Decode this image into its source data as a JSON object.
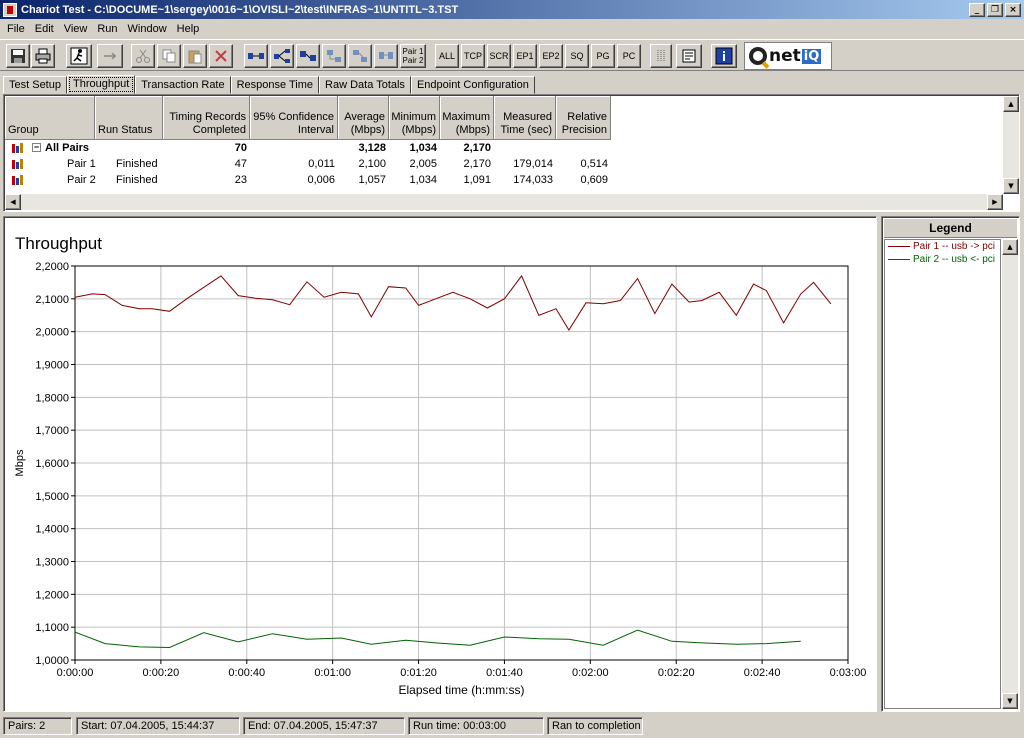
{
  "window": {
    "title": "Chariot Test - C:\\DOCUME~1\\sergey\\0016~1\\OVISLI~2\\test\\INFRAS~1\\UNTITL~3.TST",
    "minimize": "_",
    "maximize": "❐",
    "close": "×"
  },
  "menu": {
    "items": [
      "File",
      "Edit",
      "View",
      "Run",
      "Window",
      "Help"
    ]
  },
  "toolbar": {
    "pair_label_1": "Pair 1",
    "pair_label_2": "Pair 2",
    "all": "ALL",
    "tcp": "TCP",
    "scr": "SCR",
    "ep1": "EP1",
    "ep2": "EP2",
    "sq": "SQ",
    "pg": "PG",
    "pc": "PC",
    "info": "i",
    "logo_net": "net",
    "logo_iq": "iQ"
  },
  "tabs": [
    "Test Setup",
    "Throughput",
    "Transaction Rate",
    "Response Time",
    "Raw Data Totals",
    "Endpoint Configuration"
  ],
  "active_tab": "Throughput",
  "grid": {
    "columns": [
      {
        "l1": "",
        "l2": "Group"
      },
      {
        "l1": "",
        "l2": "Run Status"
      },
      {
        "l1": "Timing Records",
        "l2": "Completed"
      },
      {
        "l1": "95% Confidence",
        "l2": "Interval"
      },
      {
        "l1": "Average",
        "l2": "(Mbps)"
      },
      {
        "l1": "Minimum",
        "l2": "(Mbps)"
      },
      {
        "l1": "Maximum",
        "l2": "(Mbps)"
      },
      {
        "l1": "Measured",
        "l2": "Time (sec)"
      },
      {
        "l1": "Relative",
        "l2": "Precision"
      }
    ],
    "rows": [
      {
        "group": "All Pairs",
        "status": "",
        "records": "70",
        "ci": "",
        "avg": "3,128",
        "min": "1,034",
        "max": "2,170",
        "time": "",
        "precision": ""
      },
      {
        "group": "Pair 1",
        "status": "Finished",
        "records": "47",
        "ci": "0,011",
        "avg": "2,100",
        "min": "2,005",
        "max": "2,170",
        "time": "179,014",
        "precision": "0,514"
      },
      {
        "group": "Pair 2",
        "status": "Finished",
        "records": "23",
        "ci": "0,006",
        "avg": "1,057",
        "min": "1,034",
        "max": "1,091",
        "time": "174,033",
        "precision": "0,609"
      }
    ]
  },
  "legend": {
    "title": "Legend",
    "items": [
      {
        "label": "Pair 1 -- usb -> pci",
        "color": "#800000"
      },
      {
        "label": "Pair 2 -- usb <- pci",
        "color": "#006400"
      }
    ]
  },
  "status": {
    "pairs": "Pairs: 2",
    "start": "Start: 07.04.2005, 15:44:37",
    "end": "End: 07.04.2005, 15:47:37",
    "runtime": "Run time: 00:03:00",
    "result": "Ran to completion"
  },
  "chart_data": {
    "type": "line",
    "title": "Throughput",
    "xlabel": "Elapsed time (h:mm:ss)",
    "ylabel": "Mbps",
    "xlim": [
      0,
      180
    ],
    "ylim": [
      1.0,
      2.2
    ],
    "x_ticks": [
      0,
      20,
      40,
      60,
      80,
      100,
      120,
      140,
      160,
      180
    ],
    "x_tick_labels": [
      "0:00:00",
      "0:00:20",
      "0:00:40",
      "0:01:00",
      "0:01:20",
      "0:01:40",
      "0:02:00",
      "0:02:20",
      "0:02:40",
      "0:03:00"
    ],
    "y_ticks": [
      1.0,
      1.1,
      1.2,
      1.3,
      1.4,
      1.5,
      1.6,
      1.7,
      1.8,
      1.9,
      2.0,
      2.1,
      2.2
    ],
    "y_tick_labels": [
      "1,0000",
      "1,1000",
      "1,2000",
      "1,3000",
      "1,4000",
      "1,5000",
      "1,6000",
      "1,7000",
      "1,8000",
      "1,9000",
      "2,0000",
      "2,1000",
      "2,2000"
    ],
    "grid": true,
    "legend": "right-panel",
    "series": [
      {
        "name": "Pair 1 -- usb -> pci",
        "color": "#800000",
        "x": [
          0,
          4,
          7,
          11,
          15,
          18,
          22,
          26,
          30,
          34,
          38,
          42,
          46,
          50,
          54,
          58,
          62,
          66,
          69,
          73,
          77,
          80,
          84,
          88,
          92,
          96,
          100,
          104,
          108,
          112,
          115,
          119,
          123,
          127,
          131,
          135,
          139,
          143,
          146,
          150,
          154,
          158,
          161,
          165,
          169,
          172,
          176
        ],
        "y": [
          2.105,
          2.115,
          2.113,
          2.08,
          2.07,
          2.07,
          2.062,
          2.1,
          2.135,
          2.17,
          2.11,
          2.102,
          2.097,
          2.082,
          2.152,
          2.105,
          2.12,
          2.115,
          2.045,
          2.137,
          2.133,
          2.08,
          2.1,
          2.12,
          2.1,
          2.072,
          2.1,
          2.17,
          2.05,
          2.07,
          2.005,
          2.088,
          2.085,
          2.095,
          2.162,
          2.055,
          2.145,
          2.09,
          2.095,
          2.12,
          2.05,
          2.145,
          2.125,
          2.027,
          2.115,
          2.15,
          2.085
        ]
      },
      {
        "name": "Pair 2 -- usb <- pci",
        "color": "#006400",
        "x": [
          0,
          7,
          15,
          22,
          30,
          38,
          46,
          54,
          62,
          69,
          77,
          84,
          92,
          100,
          108,
          115,
          123,
          131,
          139,
          146,
          154,
          161,
          169
        ],
        "y": [
          1.085,
          1.05,
          1.04,
          1.038,
          1.083,
          1.055,
          1.08,
          1.063,
          1.067,
          1.048,
          1.06,
          1.052,
          1.045,
          1.07,
          1.065,
          1.063,
          1.045,
          1.091,
          1.057,
          1.052,
          1.048,
          1.05,
          1.057
        ]
      }
    ]
  }
}
